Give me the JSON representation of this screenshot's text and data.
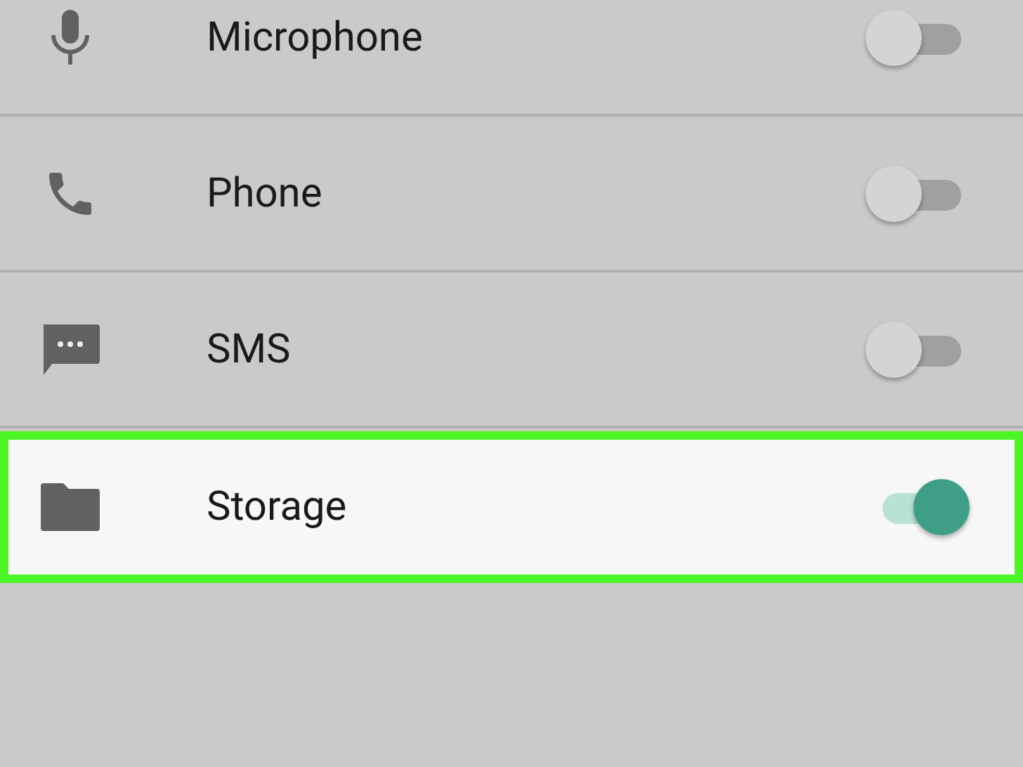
{
  "permissions": [
    {
      "label": "Microphone",
      "on": false,
      "highlighted": false
    },
    {
      "label": "Phone",
      "on": false,
      "highlighted": false
    },
    {
      "label": "SMS",
      "on": false,
      "highlighted": false
    },
    {
      "label": "Storage",
      "on": true,
      "highlighted": true
    }
  ]
}
